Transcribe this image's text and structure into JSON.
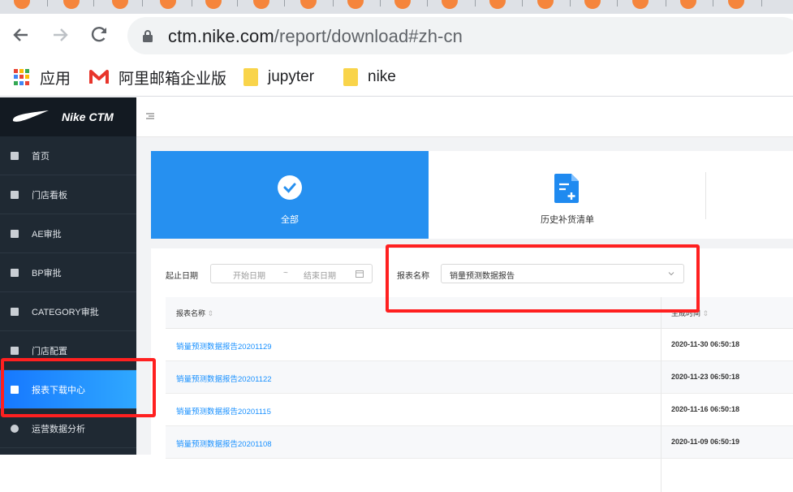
{
  "browser": {
    "url_host": "ctm.nike.com",
    "url_path": "/report/download#zh-cn",
    "bookmarks": [
      {
        "label": "应用",
        "icon": "apps-grid-icon"
      },
      {
        "label": "阿里邮箱企业版",
        "icon": "mail-m-icon"
      },
      {
        "label": "jupyter",
        "icon": "folder-icon"
      },
      {
        "label": "nike",
        "icon": "folder-icon"
      }
    ]
  },
  "app": {
    "brand": "Nike CTM",
    "accent": "#1677ff",
    "sidebar": [
      {
        "label": "首页",
        "icon": "home-icon"
      },
      {
        "label": "门店看板",
        "icon": "dashboard-icon"
      },
      {
        "label": "AE审批",
        "icon": "ae-icon"
      },
      {
        "label": "BP审批",
        "icon": "bp-icon"
      },
      {
        "label": "CATEGORY审批",
        "icon": "category-icon"
      },
      {
        "label": "门店配置",
        "icon": "store-icon"
      },
      {
        "label": "报表下载中心",
        "icon": "download-icon",
        "active": true
      },
      {
        "label": "运营数据分析",
        "icon": "pie-chart-icon"
      }
    ]
  },
  "cards": [
    {
      "label": "全部",
      "icon": "check-circle-icon",
      "active": true
    },
    {
      "label": "历史补货清单",
      "icon": "document-add-icon",
      "active": false
    }
  ],
  "filters": {
    "date_label": "起止日期",
    "start_placeholder": "开始日期",
    "range_sep": "~",
    "end_placeholder": "结束日期",
    "report_label": "报表名称",
    "report_value": "销量预测数据报告"
  },
  "table": {
    "headers": [
      "报表名称",
      "生成时间"
    ],
    "rows": [
      {
        "name": "销量预测数据报告20201129",
        "time": "2020-11-30 06:50:18"
      },
      {
        "name": "销量预测数据报告20201122",
        "time": "2020-11-23 06:50:18"
      },
      {
        "name": "销量预测数据报告20201115",
        "time": "2020-11-16 06:50:18"
      },
      {
        "name": "销量预测数据报告20201108",
        "time": "2020-11-09 06:50:19"
      }
    ]
  }
}
